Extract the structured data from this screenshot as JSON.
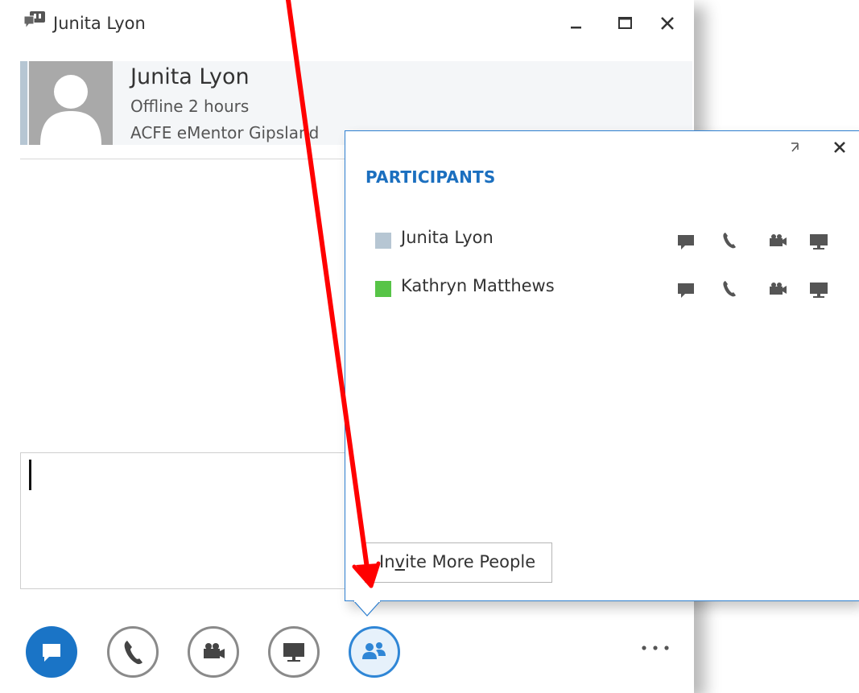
{
  "window": {
    "title": "Junita Lyon",
    "controls": [
      "minimize",
      "maximize",
      "close"
    ]
  },
  "contact": {
    "name": "Junita Lyon",
    "status": "Offline 2 hours",
    "organization": "ACFE eMentor Gipsland",
    "presence_color": "#b6c6d3"
  },
  "participants_panel": {
    "heading": "PARTICIPANTS",
    "participants": [
      {
        "name": "Junita Lyon",
        "presence": "offline",
        "presence_color": "#b6c6d3"
      },
      {
        "name": "Kathryn Matthews",
        "presence": "available",
        "presence_color": "#57c447"
      }
    ],
    "actions": [
      "im-icon",
      "phone-icon",
      "video-icon",
      "present-icon"
    ],
    "invite": {
      "before": "In",
      "underlined": "v",
      "after": "ite More People"
    }
  },
  "toolbar": {
    "buttons": [
      "im-icon",
      "phone-icon",
      "video-icon",
      "present-icon",
      "people-icon"
    ],
    "more_label": "..."
  },
  "colors": {
    "accent": "#1a74c6",
    "heading": "#1b6fbf",
    "annotation_arrow": "#ff0000"
  }
}
